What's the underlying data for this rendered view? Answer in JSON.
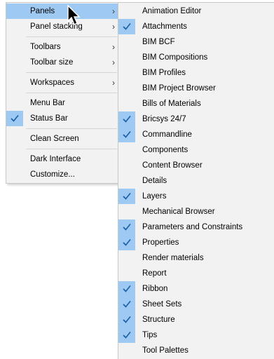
{
  "main_menu": {
    "items": [
      {
        "label": "Panels",
        "arrow": "›",
        "checked": false,
        "highlighted": true
      },
      {
        "label": "Panel stacking",
        "arrow": "›",
        "checked": false
      },
      {
        "sep": true
      },
      {
        "label": "Toolbars",
        "arrow": "›",
        "checked": false
      },
      {
        "label": "Toolbar size",
        "arrow": "›",
        "checked": false
      },
      {
        "sep": true
      },
      {
        "label": "Workspaces",
        "arrow": "›",
        "checked": false
      },
      {
        "sep": true
      },
      {
        "label": "Menu Bar",
        "checked": false
      },
      {
        "label": "Status Bar",
        "checked": true
      },
      {
        "sep": true
      },
      {
        "label": "Clean Screen",
        "checked": false
      },
      {
        "sep": true
      },
      {
        "label": "Dark Interface",
        "checked": false
      },
      {
        "label": "Customize...",
        "checked": false
      }
    ]
  },
  "panels_submenu": {
    "items": [
      {
        "label": "Animation Editor",
        "checked": false
      },
      {
        "label": "Attachments",
        "checked": true
      },
      {
        "label": "BIM BCF",
        "checked": false
      },
      {
        "label": "BIM Compositions",
        "checked": false
      },
      {
        "label": "BIM Profiles",
        "checked": false
      },
      {
        "label": "BIM Project Browser",
        "checked": false
      },
      {
        "label": "Bills of Materials",
        "checked": false
      },
      {
        "label": "Bricsys 24/7",
        "checked": true
      },
      {
        "label": "Commandline",
        "checked": true
      },
      {
        "label": "Components",
        "checked": false
      },
      {
        "label": "Content Browser",
        "checked": false
      },
      {
        "label": "Details",
        "checked": false
      },
      {
        "label": "Layers",
        "checked": true
      },
      {
        "label": "Mechanical Browser",
        "checked": false
      },
      {
        "label": "Parameters and Constraints",
        "checked": true
      },
      {
        "label": "Properties",
        "checked": true
      },
      {
        "label": "Render materials",
        "checked": false
      },
      {
        "label": "Report",
        "checked": false
      },
      {
        "label": "Ribbon",
        "checked": true
      },
      {
        "label": "Sheet Sets",
        "checked": true
      },
      {
        "label": "Structure",
        "checked": true
      },
      {
        "label": "Tips",
        "checked": true
      },
      {
        "label": "Tool Palettes",
        "checked": false
      }
    ]
  },
  "icons": {
    "check": "check-icon",
    "submenu": "chevron-right-icon",
    "cursor": "mouse-pointer-icon"
  },
  "colors": {
    "menu_bg": "#f2f2f2",
    "highlight": "#9ec9f2",
    "check": "#1a5fa8"
  }
}
